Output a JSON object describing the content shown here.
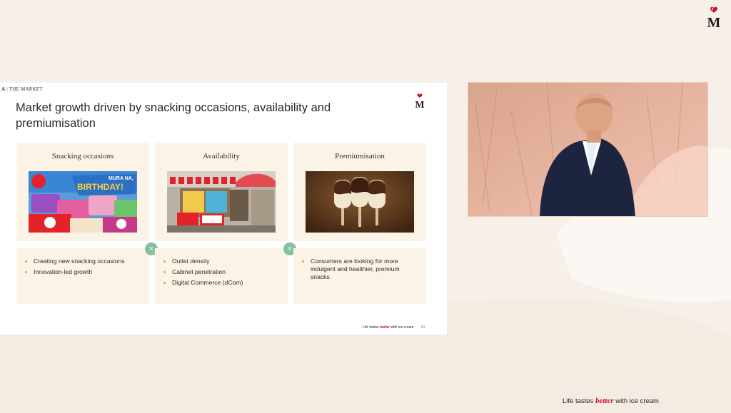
{
  "brand": {
    "logo_letter": "M"
  },
  "slide": {
    "section_prefix": "A",
    "section_label": "THE MARKET",
    "title": "Market growth driven by snacking occasions, availability and premiumisation",
    "columns": [
      {
        "heading": "Snacking occasions",
        "image": "ice-cream-promo-packs",
        "bullets": [
          "Creating new snacking occasions",
          "Innovation-led growth"
        ]
      },
      {
        "heading": "Availability",
        "image": "storefront-with-ice-cream-cabinet",
        "bullets": [
          "Outlet density",
          "Cabinet penetration",
          "Digital Commerce (dCom)"
        ]
      },
      {
        "heading": "Premiumisation",
        "image": "chocolate-dipped-ice-cream-bars",
        "bullets": [
          "Consumers are looking for more indulgent and healthier, premium snacks"
        ]
      }
    ],
    "connector_symbol": "×",
    "footer": {
      "pre": "Life tastes ",
      "em": "better",
      "post": " with ice cream",
      "page": "14"
    }
  },
  "video": {
    "content": "presenter-speaking"
  },
  "tagline": {
    "pre": "Life tastes ",
    "em": "better",
    "post": " with ice cream"
  },
  "colors": {
    "background": "#f6f0e8",
    "card": "#fbf4e6",
    "accent_red": "#c8102e",
    "connector_green": "#86c0a3",
    "bullet": "#d4a44d"
  }
}
